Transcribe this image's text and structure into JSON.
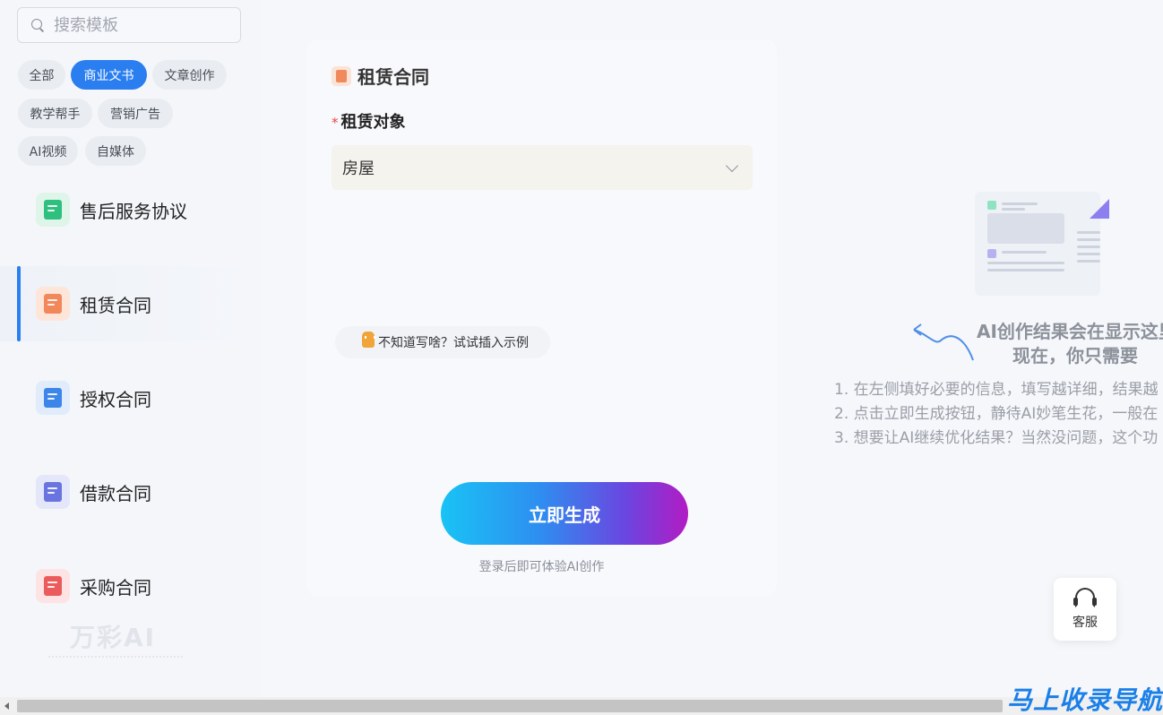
{
  "search": {
    "placeholder": "搜索模板"
  },
  "tags": [
    {
      "label": "全部"
    },
    {
      "label": "商业文书"
    },
    {
      "label": "文章创作"
    },
    {
      "label": "教学帮手"
    },
    {
      "label": "营销广告"
    },
    {
      "label": "AI视频"
    },
    {
      "label": "自媒体"
    }
  ],
  "sidebar": {
    "items": [
      {
        "label": "售后服务协议",
        "icon": "document-check-icon"
      },
      {
        "label": "租赁合同",
        "icon": "contract-star-icon"
      },
      {
        "label": "授权合同",
        "icon": "authorization-icon"
      },
      {
        "label": "借款合同",
        "icon": "loan-icon"
      },
      {
        "label": "采购合同",
        "icon": "purchase-icon"
      }
    ],
    "watermark": "万彩AI"
  },
  "form": {
    "title": "租赁合同",
    "field_label": "租赁对象",
    "required_mark": "*",
    "select_value": "房屋",
    "hint": "不知道写啥？试试插入示例",
    "generate_label": "立即生成",
    "login_tip": "登录后即可体验AI创作"
  },
  "result": {
    "title": "AI创作结果会在显示这里",
    "subtitle": "现在，你只需要",
    "steps": [
      "1. 在左侧填好必要的信息，填写越详细，结果越",
      "2. 点击立即生成按钮，静待AI妙笔生花，一般在",
      "3. 想要让AI继续优化结果？当然没问题，这个功"
    ]
  },
  "service": {
    "label": "客服"
  },
  "brand": "马上收录导航",
  "colors": {
    "accent": "#2a7ef0",
    "generate_gradient": [
      "#19c3f5",
      "#2e8ef0",
      "#6b45e0",
      "#b21cc3"
    ],
    "required": "#e5484d"
  }
}
